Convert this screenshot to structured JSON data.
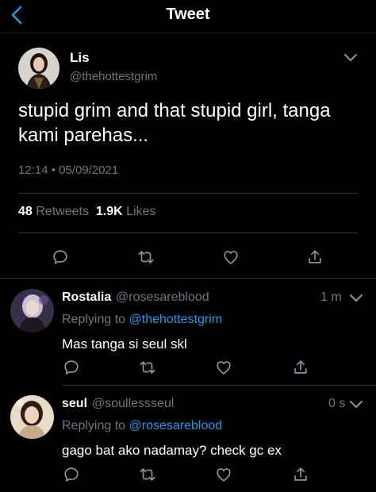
{
  "header": {
    "title": "Tweet",
    "back_icon": "chevron-left-icon",
    "accent": "#1d9bf0"
  },
  "tweet": {
    "author_name": "Lis",
    "author_handle": "@thehottestgrim",
    "text": "stupid grim and that stupid girl, tanga kami parehas...",
    "timestamp": "12:14 • 05/09/2021",
    "retweets_count": "48",
    "retweets_label": "Retweets",
    "likes_count": "1.9K",
    "likes_label": "Likes",
    "actions": [
      "reply-icon",
      "retweet-icon",
      "like-icon",
      "share-icon"
    ]
  },
  "replies": [
    {
      "name": "Rostalia",
      "handle": "@rosesareblood",
      "time": "1 m",
      "replying_prefix": "Replying to",
      "replying_to": "@thehottestgrim",
      "text": "Mas tanga si seul skl"
    },
    {
      "name": "seul",
      "handle": "@soullessseul",
      "time": "0 s",
      "replying_prefix": "Replying to",
      "replying_to": "@rosesareblood",
      "text": "gago bat ako nadamay? check gc ex"
    }
  ],
  "colors": {
    "background": "#000000",
    "text": "#ffffff",
    "muted": "#6e767d",
    "link": "#1d9bf0",
    "divider": "#2f3336"
  }
}
